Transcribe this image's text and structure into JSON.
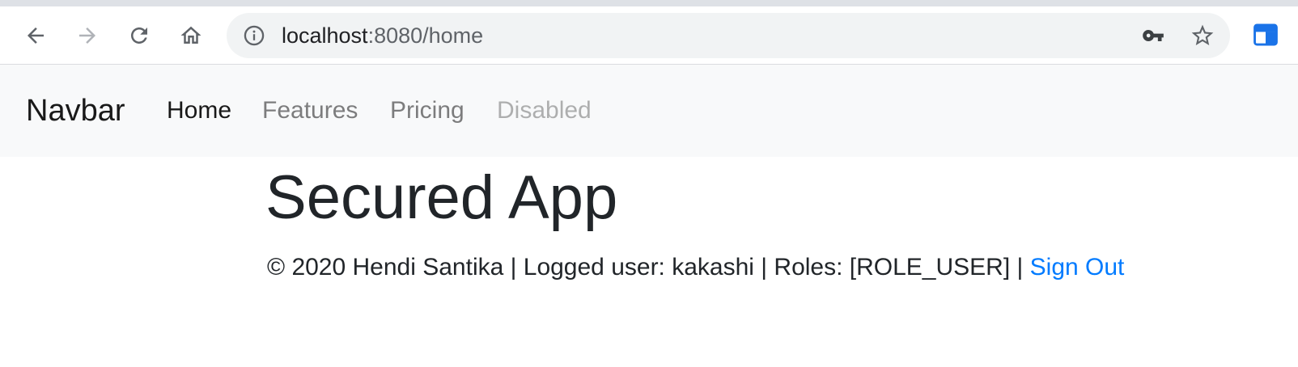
{
  "browser": {
    "url_host": "localhost",
    "url_rest": ":8080/home",
    "icons": {
      "back": "arrow-left-icon",
      "forward": "arrow-right-icon",
      "reload": "reload-icon",
      "home": "home-icon",
      "info": "info-icon",
      "key": "key-icon",
      "star": "star-icon",
      "extension": "extension-icon"
    },
    "colors": {
      "toolbar_bg": "#ffffff",
      "omnibox_bg": "#f1f3f4",
      "extension_blue": "#1a73e8"
    }
  },
  "navbar": {
    "brand": "Navbar",
    "links": [
      {
        "label": "Home",
        "state": "active"
      },
      {
        "label": "Features",
        "state": "normal"
      },
      {
        "label": "Pricing",
        "state": "normal"
      },
      {
        "label": "Disabled",
        "state": "disabled"
      }
    ],
    "colors": {
      "bg": "#f8f9fa"
    }
  },
  "main": {
    "title": "Secured App",
    "footer_text": "© 2020 Hendi Santika | Logged user: kakashi | Roles: [ROLE_USER] |",
    "sign_out_label": "Sign Out",
    "colors": {
      "text": "#212529",
      "link": "#007bff"
    }
  }
}
